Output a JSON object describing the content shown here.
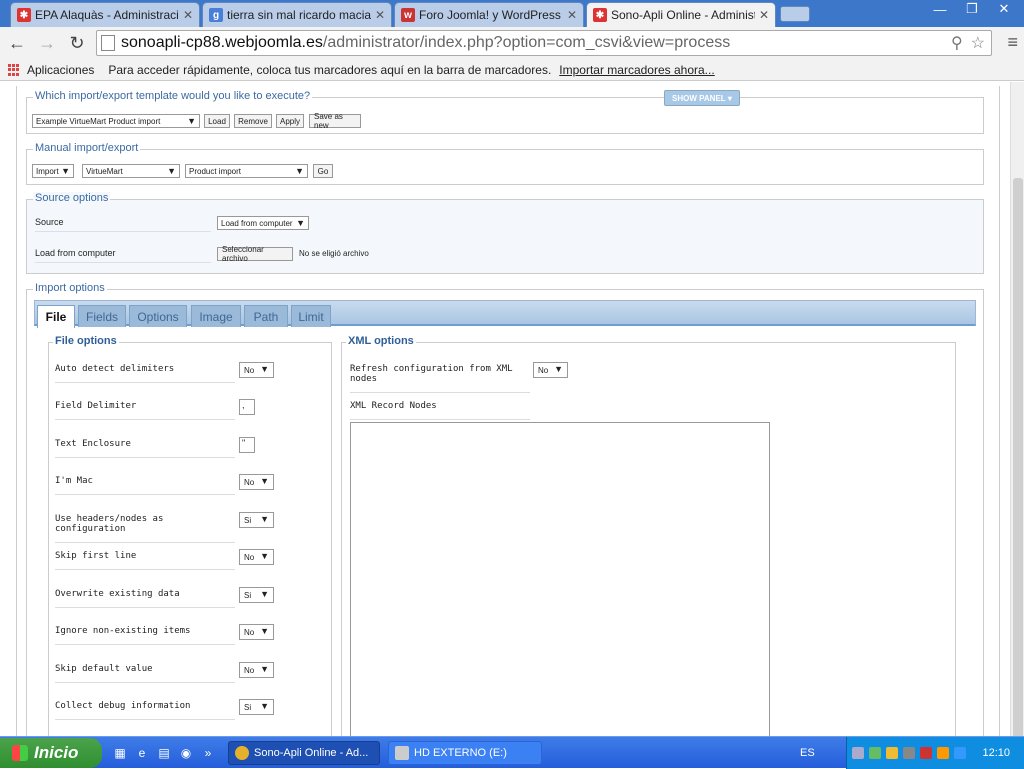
{
  "browser": {
    "tabs": [
      {
        "title": "EPA Alaquàs - Administración",
        "favicon": "joomla-icon",
        "color": "#d33"
      },
      {
        "title": "tierra sin mal ricardo macian",
        "favicon": "google-icon",
        "color": "#4a7fd8"
      },
      {
        "title": "Foro Joomla! y WordPress :: ",
        "favicon": "w-icon",
        "color": "#c33"
      },
      {
        "title": "Sono-Apli Online - Administra",
        "favicon": "joomla-icon",
        "color": "#d33"
      }
    ],
    "url_host": "sonoapli-cp88.webjoomla.es",
    "url_path": "/administrator/index.php?option=com_csvi&view=process",
    "bookmarks": {
      "apps_label": "Aplicaciones",
      "hint": "Para acceder rápidamente, coloca tus marcadores aquí en la barra de marcadores.",
      "import_link": "Importar marcadores ahora..."
    }
  },
  "template_section": {
    "legend": "Which import/export template would you like to execute?",
    "selected_template": "Example VirtueMart Product import",
    "buttons": [
      "Load",
      "Remove",
      "Apply",
      "Save as new"
    ],
    "show_panel": "SHOW PANEL"
  },
  "manual_section": {
    "legend": "Manual import/export",
    "action": "Import",
    "component": "VirtueMart",
    "operation": "Product import",
    "go": "Go"
  },
  "source_section": {
    "legend": "Source options",
    "source_label": "Source",
    "source_value": "Load from computer",
    "load_label": "Load from computer",
    "file_button": "Seleccionar archivo",
    "file_status": "No se eligió archivo"
  },
  "import_section": {
    "legend": "Import options",
    "tabs": [
      "File",
      "Fields",
      "Options",
      "Image",
      "Path",
      "Limit"
    ],
    "file_options_title": "File options",
    "rows": [
      {
        "label": "Auto detect delimiters",
        "value": "No",
        "kind": "select"
      },
      {
        "label": "Field Delimiter",
        "value": ",",
        "kind": "text"
      },
      {
        "label": "Text Enclosure",
        "value": "\"",
        "kind": "text"
      },
      {
        "label": "I'm Mac",
        "value": "No",
        "kind": "select"
      },
      {
        "label": "Use headers/nodes as configuration",
        "value": "Si",
        "kind": "select"
      },
      {
        "label": "Skip first line",
        "value": "No",
        "kind": "select"
      },
      {
        "label": "Overwrite existing data",
        "value": "Si",
        "kind": "select"
      },
      {
        "label": "Ignore non-existing items",
        "value": "No",
        "kind": "select"
      },
      {
        "label": "Skip default value",
        "value": "No",
        "kind": "select"
      },
      {
        "label": "Collect debug information",
        "value": "Si",
        "kind": "select"
      }
    ],
    "xml_options_title": "XML options",
    "refresh_label": "Refresh configuration from XML nodes",
    "refresh_value": "No",
    "record_nodes_label": "XML Record Nodes"
  },
  "taskbar": {
    "start": "Inicio",
    "tasks": [
      "Sono-Apli Online - Ad...",
      "HD EXTERNO (E:)"
    ],
    "lang": "ES",
    "clock": "12:10"
  }
}
